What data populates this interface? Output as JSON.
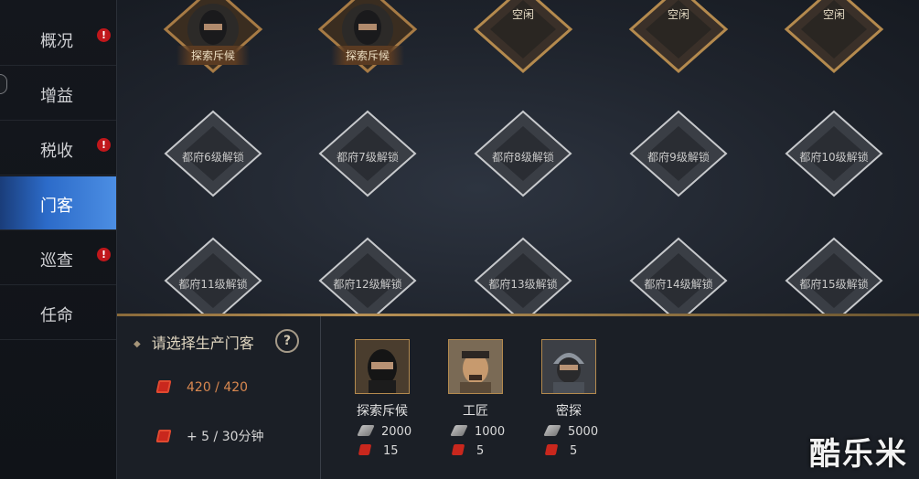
{
  "sidebar": {
    "items": [
      {
        "label": "概况",
        "alert": "!"
      },
      {
        "label": "增益",
        "alert": ""
      },
      {
        "label": "税收",
        "alert": "!"
      },
      {
        "label": "门客",
        "alert": ""
      },
      {
        "label": "巡查",
        "alert": "!"
      },
      {
        "label": "任命",
        "alert": ""
      }
    ]
  },
  "slots": {
    "row1": [
      {
        "state": "busy",
        "label": "探索斥候"
      },
      {
        "state": "busy",
        "label": "探索斥候"
      },
      {
        "state": "idle",
        "label": "空闲"
      },
      {
        "state": "idle",
        "label": "空闲"
      },
      {
        "state": "idle",
        "label": "空闲"
      }
    ],
    "row2": [
      {
        "state": "locked",
        "label": "都府6级解锁"
      },
      {
        "state": "locked",
        "label": "都府7级解锁"
      },
      {
        "state": "locked",
        "label": "都府8级解锁"
      },
      {
        "state": "locked",
        "label": "都府9级解锁"
      },
      {
        "state": "locked",
        "label": "都府10级解锁"
      }
    ],
    "row3": [
      {
        "state": "locked",
        "label": "都府11级解锁"
      },
      {
        "state": "locked",
        "label": "都府12级解锁"
      },
      {
        "state": "locked",
        "label": "都府13级解锁"
      },
      {
        "state": "locked",
        "label": "都府14级解锁"
      },
      {
        "state": "locked",
        "label": "都府15级解锁"
      }
    ]
  },
  "panel": {
    "title": "请选择生产门客",
    "help": "?",
    "capacity": "420 / 420",
    "rate": "+ 5 / 30分钟",
    "guests": [
      {
        "name": "探索斥候",
        "silk": "2000",
        "scroll": "15"
      },
      {
        "name": "工匠",
        "silk": "1000",
        "scroll": "5"
      },
      {
        "name": "密探",
        "silk": "5000",
        "scroll": "5"
      }
    ]
  },
  "watermark": "酷乐米",
  "colors": {
    "active_tab": "#2c6bc9",
    "alert": "#c0171b",
    "capacity": "#d98850",
    "gold_frame": "#b48a4e"
  }
}
